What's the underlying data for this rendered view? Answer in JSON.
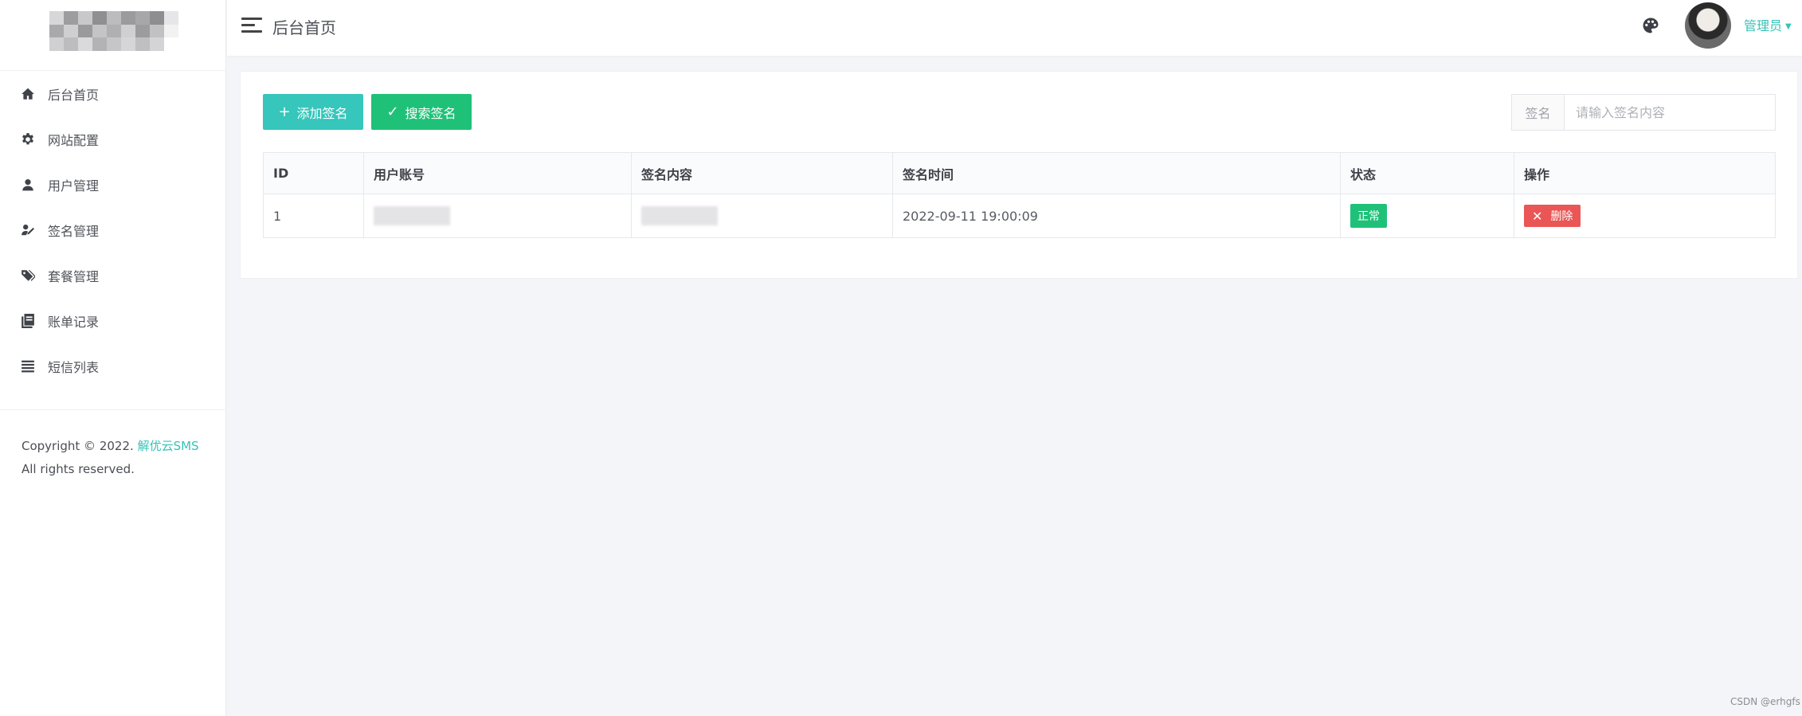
{
  "header": {
    "title": "后台首页",
    "user_name": "管理员"
  },
  "sidebar": {
    "items": [
      {
        "label": "后台首页",
        "icon": "home-icon"
      },
      {
        "label": "网站配置",
        "icon": "gear-icon"
      },
      {
        "label": "用户管理",
        "icon": "user-icon"
      },
      {
        "label": "签名管理",
        "icon": "signature-icon"
      },
      {
        "label": "套餐管理",
        "icon": "tags-icon"
      },
      {
        "label": "账单记录",
        "icon": "book-icon"
      },
      {
        "label": "短信列表",
        "icon": "list-icon"
      }
    ],
    "copyright_prefix": "Copyright © 2022.",
    "copyright_brand": "解优云SMS",
    "copyright_suffix": "All rights reserved."
  },
  "toolbar": {
    "add_label": "添加签名",
    "search_label": "搜索签名"
  },
  "search": {
    "label": "签名",
    "placeholder": "请输入签名内容"
  },
  "table": {
    "columns": [
      "ID",
      "用户账号",
      "签名内容",
      "签名时间",
      "状态",
      "操作"
    ],
    "rows": [
      {
        "id": "1",
        "time": "2022-09-11 19:00:09",
        "status": "正常",
        "action": "删除"
      }
    ]
  },
  "watermark": "CSDN @erhgfs",
  "colors": {
    "accent": "#36c3b6",
    "success": "#1fc178",
    "danger": "#ea5656"
  }
}
